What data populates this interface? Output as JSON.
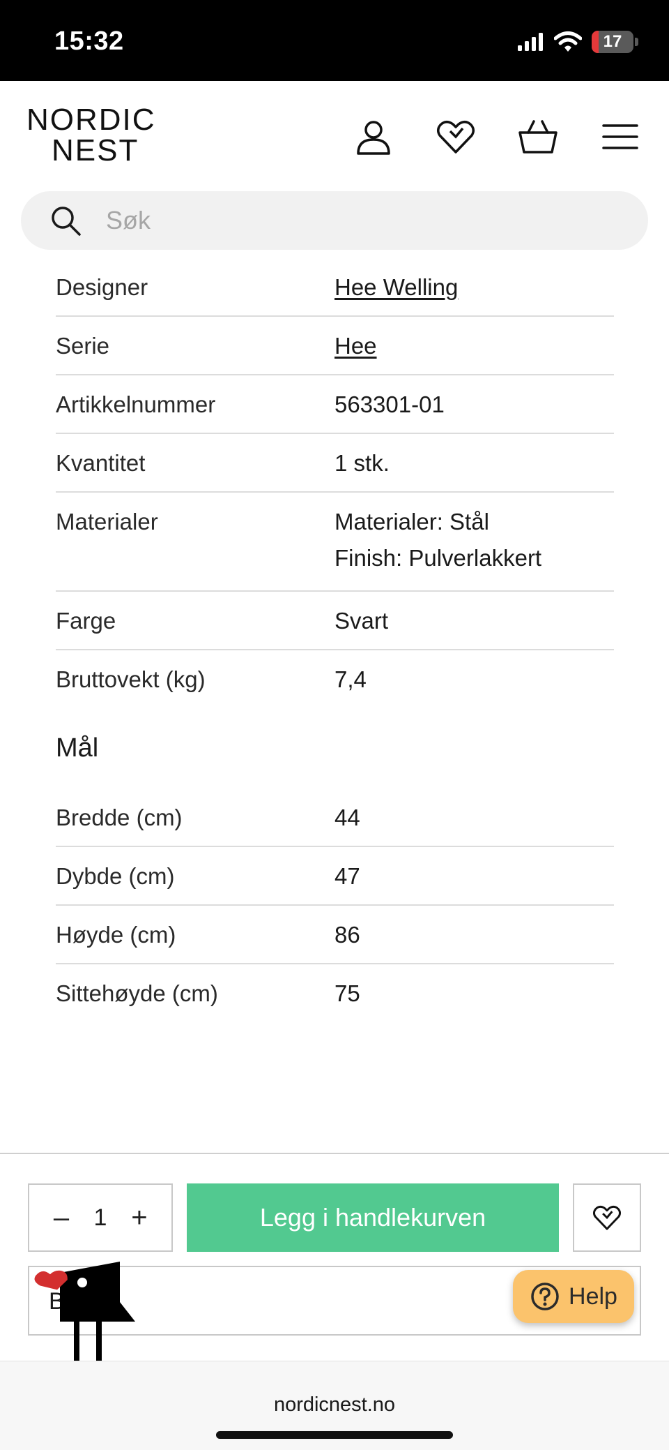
{
  "status_bar": {
    "time": "15:32",
    "battery": "17",
    "battery_level": 0.17
  },
  "header": {
    "logo_line1": "NORDIC",
    "logo_line2": "NEST"
  },
  "search": {
    "placeholder": "Søk"
  },
  "specs": [
    {
      "label": "Designer",
      "value": "Hee Welling",
      "link": true
    },
    {
      "label": "Serie",
      "value": "Hee",
      "link": true
    },
    {
      "label": "Artikkelnummer",
      "value": "563301-01"
    },
    {
      "label": "Kvantitet",
      "value": "1 stk."
    },
    {
      "label": "Materialer",
      "value_line1": "Materialer: Stål",
      "value_line2": "Finish: Pulverlakkert"
    },
    {
      "label": "Farge",
      "value": "Svart"
    },
    {
      "label": "Bruttovekt (kg)",
      "value": "7,4"
    }
  ],
  "dimensions": {
    "title": "Mål",
    "rows": [
      {
        "label": "Bredde (cm)",
        "value": "44"
      },
      {
        "label": "Dybde (cm)",
        "value": "47"
      },
      {
        "label": "Høyde (cm)",
        "value": "86"
      },
      {
        "label": "Sittehøyde (cm)",
        "value": "75"
      }
    ]
  },
  "cart": {
    "minus": "–",
    "plus": "+",
    "quantity": "1",
    "add_label": "Legg i handlekurven",
    "second_box_text": "B"
  },
  "help": {
    "label": "Help"
  },
  "url": "nordicnest.no",
  "colors": {
    "add_button": "#52c990",
    "help_button": "#fbc36c",
    "battery_low": "#e5393a"
  }
}
